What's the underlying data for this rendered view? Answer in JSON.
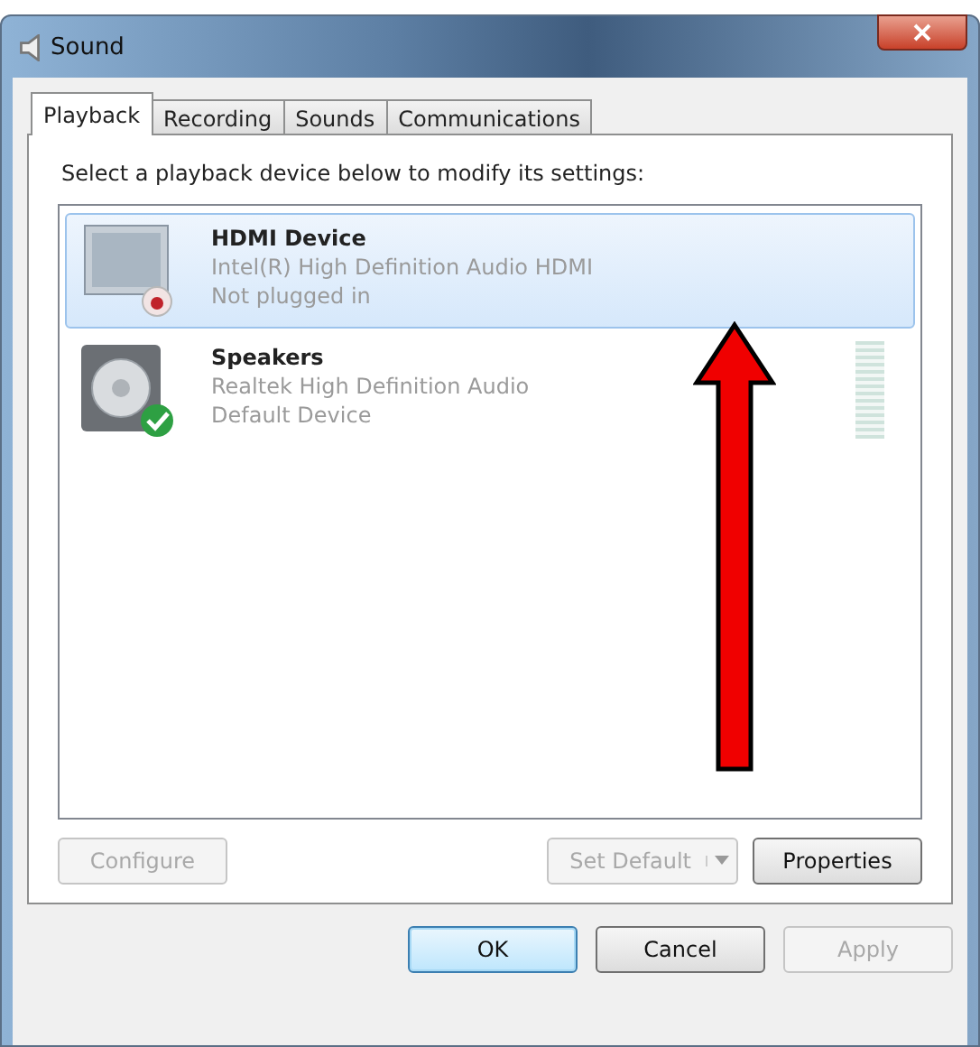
{
  "window": {
    "title": "Sound"
  },
  "tabs": [
    {
      "label": "Playback",
      "selected": true
    },
    {
      "label": "Recording",
      "selected": false
    },
    {
      "label": "Sounds",
      "selected": false
    },
    {
      "label": "Communications",
      "selected": false
    }
  ],
  "instruction": "Select a playback device below to modify its settings:",
  "devices": [
    {
      "kind": "monitor",
      "plugged_in": false,
      "name": "HDMI Device",
      "driver": "Intel(R) High Definition Audio HDMI",
      "state": "Not plugged in",
      "selected": true
    },
    {
      "kind": "speaker",
      "plugged_in": true,
      "is_default": true,
      "name": "Speakers",
      "driver": "Realtek High Definition Audio",
      "state": "Default Device",
      "selected": false,
      "level": 0
    }
  ],
  "device_buttons": [
    {
      "label": "Configure",
      "disabled": true,
      "split": false
    },
    {
      "label": "Set Default",
      "disabled": true,
      "split": true
    },
    {
      "label": "Properties",
      "disabled": false,
      "split": false
    }
  ],
  "dialog_buttons": [
    {
      "label": "OK",
      "disabled": false,
      "default": true
    },
    {
      "label": "Cancel",
      "disabled": false,
      "default": false
    },
    {
      "label": "Apply",
      "disabled": true,
      "default": false
    }
  ]
}
